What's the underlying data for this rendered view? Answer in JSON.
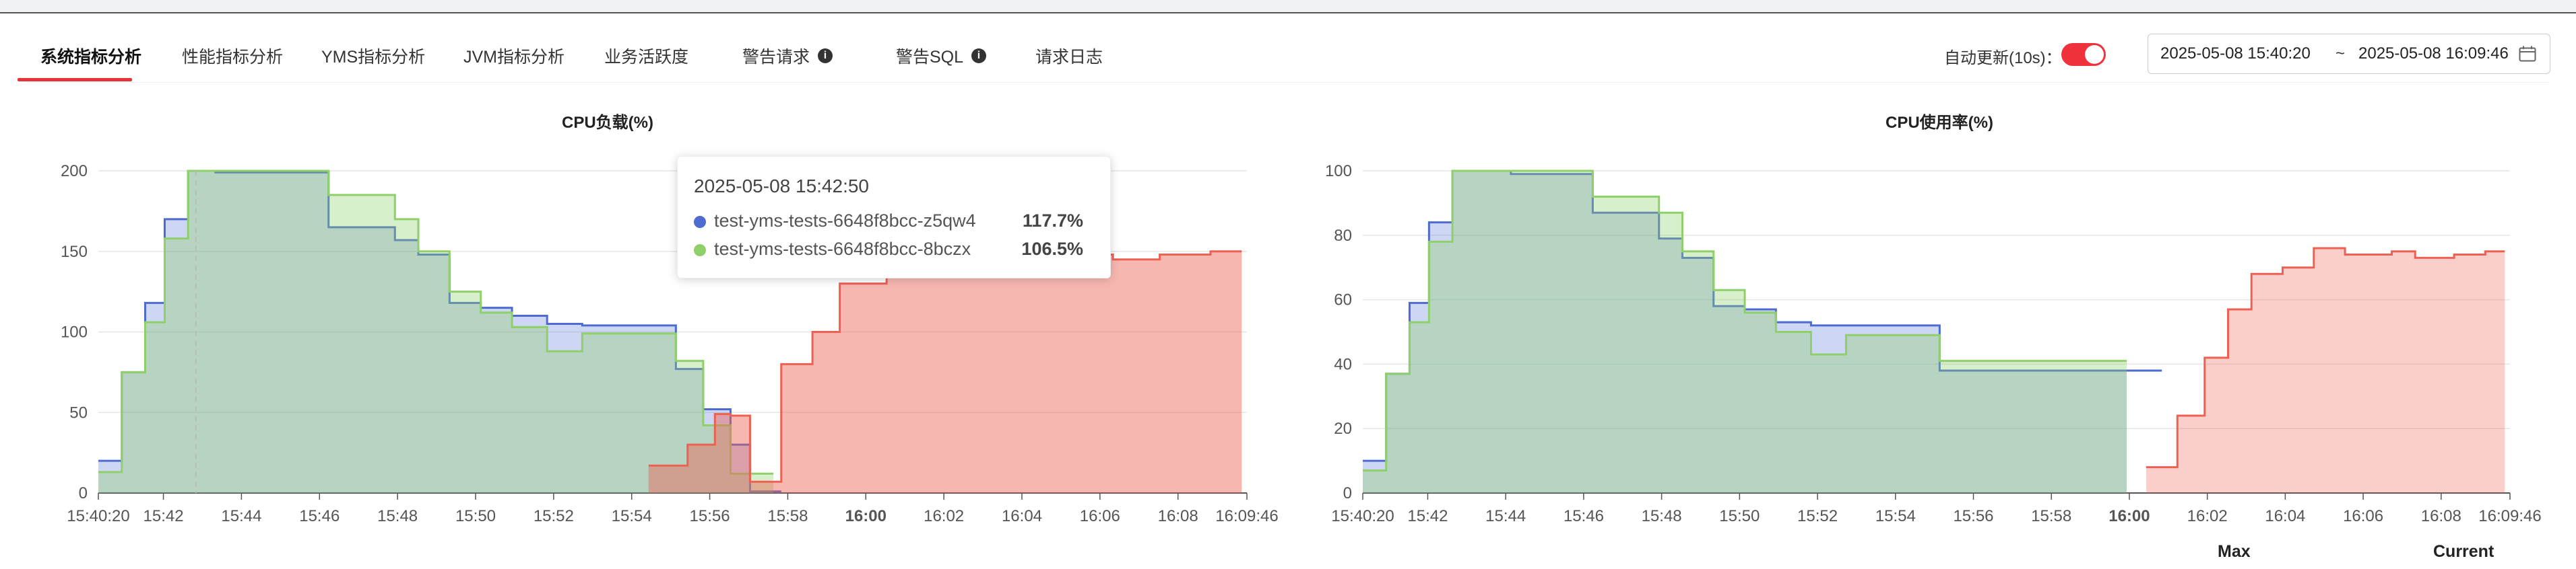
{
  "tabs": [
    {
      "label": "系统指标分析",
      "active": true,
      "info": false
    },
    {
      "label": "性能指标分析",
      "active": false,
      "info": false
    },
    {
      "label": "YMS指标分析",
      "active": false,
      "info": false
    },
    {
      "label": "JVM指标分析",
      "active": false,
      "info": false
    },
    {
      "label": "业务活跃度",
      "active": false,
      "info": false
    },
    {
      "label": "警告请求",
      "active": false,
      "info": true
    },
    {
      "label": "警告SQL",
      "active": false,
      "info": true
    },
    {
      "label": "请求日志",
      "active": false,
      "info": false
    }
  ],
  "toolbar": {
    "auto_refresh_label": "自动更新(10s)：",
    "auto_refresh_on": true,
    "date_start": "2025-05-08 15:40:20",
    "date_sep": "~",
    "date_end": "2025-05-08 16:09:46",
    "calendar_icon": "calendar-icon",
    "info_icon": "info-circle-icon"
  },
  "tooltip": {
    "title": "2025-05-08 15:42:50",
    "rows": [
      {
        "name": "test-yms-tests-6648f8bcc-z5qw4",
        "value": "117.7%",
        "color": "#4d6bd0"
      },
      {
        "name": "test-yms-tests-6648f8bcc-8bczx",
        "value": "106.5%",
        "color": "#8fd06a"
      }
    ]
  },
  "legend_headers": {
    "max": "Max",
    "current": "Current"
  },
  "colors": {
    "blue": "#4d6bd0",
    "green": "#8fd06a",
    "red": "#ee6052",
    "accent": "#e8323a"
  },
  "chart_data": [
    {
      "type": "area",
      "title": "CPU负载(%)",
      "ylim": [
        0,
        200
      ],
      "yticks": [
        0,
        50,
        100,
        150,
        200
      ],
      "x_tick_labels": [
        "15:40:20",
        "15:42",
        "15:44",
        "15:46",
        "15:48",
        "15:50",
        "15:52",
        "15:54",
        "15:56",
        "15:58",
        "16:00",
        "16:02",
        "16:04",
        "16:06",
        "16:08",
        "16:09:46"
      ],
      "x_range_minutes": [
        0,
        29.433
      ],
      "grid": true,
      "series": [
        {
          "x": [
            0,
            0.6,
            1.2,
            1.7,
            2.3,
            3.0,
            3.8,
            5.9,
            7.6,
            8.2,
            9.0,
            9.8,
            10.6,
            11.5,
            12.4,
            13.8,
            14.8,
            15.5,
            16.2,
            16.7,
            17.2,
            17.5
          ],
          "y": [
            20,
            75,
            118,
            170,
            200,
            199,
            199,
            165,
            157,
            148,
            118,
            115,
            110,
            105,
            104,
            104,
            77,
            52,
            30,
            1,
            1,
            1
          ],
          "end": 17.5
        },
        {
          "x": [
            0,
            0.6,
            1.2,
            1.7,
            2.3,
            3.0,
            3.8,
            5.9,
            7.6,
            8.2,
            9.0,
            9.8,
            10.6,
            11.5,
            12.4,
            13.8,
            14.8,
            15.5,
            16.2,
            16.7
          ],
          "y": [
            13,
            75,
            106,
            158,
            200,
            200,
            200,
            185,
            170,
            150,
            125,
            112,
            103,
            88,
            99,
            99,
            82,
            42,
            12,
            12
          ],
          "end": 17.3
        },
        {
          "x": [
            14.1,
            15.1,
            15.8,
            16.2,
            16.7,
            17.5,
            18.3,
            19.0,
            20.2,
            21.2,
            22.5,
            23.8,
            24.5,
            25.2,
            26.0,
            27.2,
            28.5,
            29.3
          ],
          "y": [
            17,
            30,
            49,
            48,
            7,
            80,
            100,
            130,
            143,
            150,
            153,
            150,
            150,
            148,
            145,
            148,
            150,
            150
          ],
          "end": 29.3
        }
      ]
    },
    {
      "type": "area",
      "title": "CPU使用率(%)",
      "ylim": [
        0,
        100
      ],
      "yticks": [
        0,
        20,
        40,
        60,
        80,
        100
      ],
      "x_tick_labels": [
        "15:40:20",
        "15:42",
        "15:44",
        "15:46",
        "15:48",
        "15:50",
        "15:52",
        "15:54",
        "15:56",
        "15:58",
        "16:00",
        "16:02",
        "16:04",
        "16:06",
        "16:08",
        "16:09:46"
      ],
      "x_range_minutes": [
        0,
        29.433
      ],
      "grid": true,
      "series": [
        {
          "x": [
            0,
            0.6,
            1.2,
            1.7,
            2.3,
            3.0,
            3.8,
            5.9,
            7.6,
            8.2,
            9.0,
            9.8,
            10.6,
            11.5,
            12.4,
            13.8,
            14.8,
            15.5,
            16.2,
            16.7,
            17.2,
            17.5,
            19.5,
            20.5
          ],
          "y": [
            10,
            37,
            59,
            84,
            100,
            100,
            99,
            87,
            79,
            73,
            58,
            57,
            53,
            52,
            52,
            52,
            38,
            38,
            38,
            38,
            38,
            38,
            38,
            38
          ],
          "end": 19.6
        },
        {
          "x": [
            0,
            0.6,
            1.2,
            1.7,
            2.3,
            3.0,
            3.8,
            5.9,
            7.6,
            8.2,
            9.0,
            9.8,
            10.6,
            11.5,
            12.4,
            13.8,
            14.8,
            15.5,
            16.2,
            16.7,
            17.2,
            17.5,
            19.5
          ],
          "y": [
            7,
            37,
            53,
            78,
            100,
            100,
            100,
            92,
            87,
            75,
            63,
            56,
            50,
            43,
            49,
            49,
            41,
            41,
            41,
            41,
            41,
            41,
            41
          ],
          "end": 19.6
        },
        {
          "x": [
            20.1,
            20.9,
            21.6,
            22.2,
            22.8,
            23.6,
            24.4,
            25.2,
            25.8,
            26.4,
            27.0,
            28.0,
            28.8,
            29.3
          ],
          "y": [
            8,
            24,
            42,
            57,
            68,
            70,
            76,
            74,
            74,
            75,
            73,
            74,
            75,
            75
          ],
          "end": 29.3
        }
      ]
    }
  ]
}
